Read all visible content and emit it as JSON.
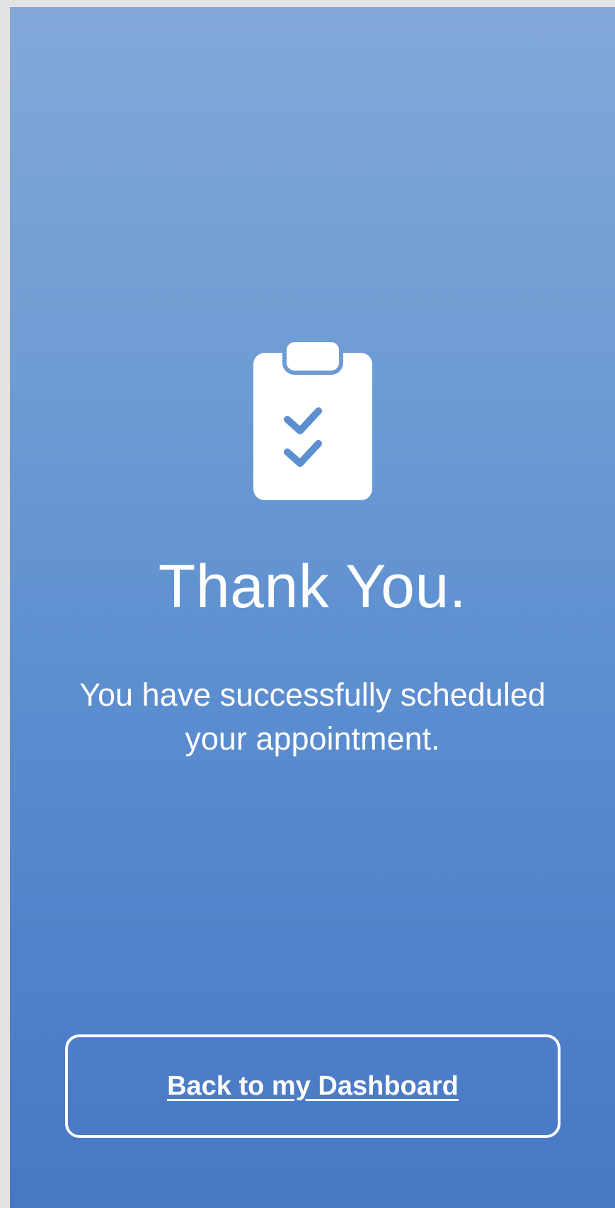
{
  "screen": {
    "icon": "clipboard-check-icon",
    "title": "Thank You.",
    "message": "You have successfully scheduled your appointment.",
    "button_label": "Back to my Dashboard"
  },
  "colors": {
    "gradient_top": "#83a8d8",
    "gradient_bottom": "#4877c4",
    "text": "#ffffff",
    "outer_background": "#e3e3e3"
  }
}
